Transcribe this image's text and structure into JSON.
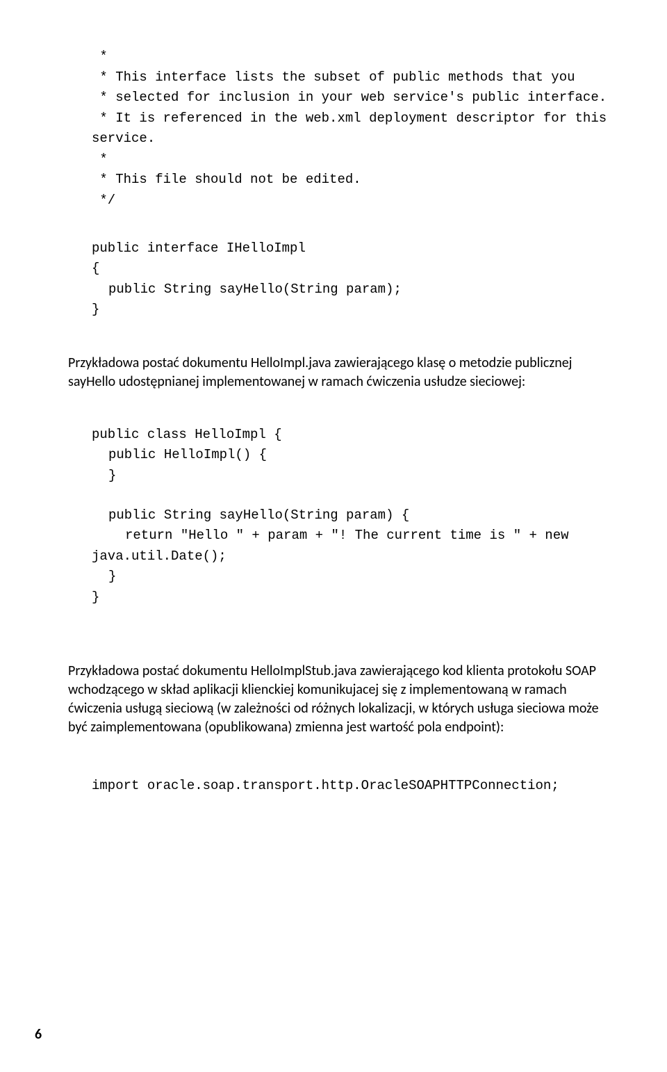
{
  "code1": {
    "l1": " *",
    "l2": " * This interface lists the subset of public methods that you",
    "l3": " * selected for inclusion in your web service's public interface.",
    "l4": " * It is referenced in the web.xml deployment descriptor for this",
    "l5": "service.",
    "l6": " *",
    "l7": " * This file should not be edited.",
    "l8": " */",
    "l9": "public interface IHelloImpl",
    "l10": "{",
    "l11": "public String sayHello(String param);",
    "l12": "}"
  },
  "prose1": "Przykładowa postać dokumentu HelloImpl.java zawierającego klasę o metodzie publicznej sayHello udostępnianej implementowanej w ramach ćwiczenia usłudze sieciowej:",
  "code2": {
    "l1": "public class HelloImpl {",
    "l2": "public HelloImpl() {",
    "l3": "}",
    "l4": "public String sayHello(String param) {",
    "l5": "return \"Hello \" + param + \"! The current time is \" + new",
    "l6": "java.util.Date();",
    "l7": "}",
    "l8": "}"
  },
  "prose2": "Przykładowa postać dokumentu HelloImplStub.java zawierającego kod klienta protokołu SOAP wchodzącego w skład aplikacji klienckiej komunikujacej się z implementowaną w ramach ćwiczenia usługą sieciową (w zależności od różnych lokalizacji, w których usługa sieciowa może być zaimplementowana (opublikowana) zmienna jest wartość pola endpoint):",
  "code3": {
    "l1": "import oracle.soap.transport.http.OracleSOAPHTTPConnection;"
  },
  "pageNumber": "6"
}
